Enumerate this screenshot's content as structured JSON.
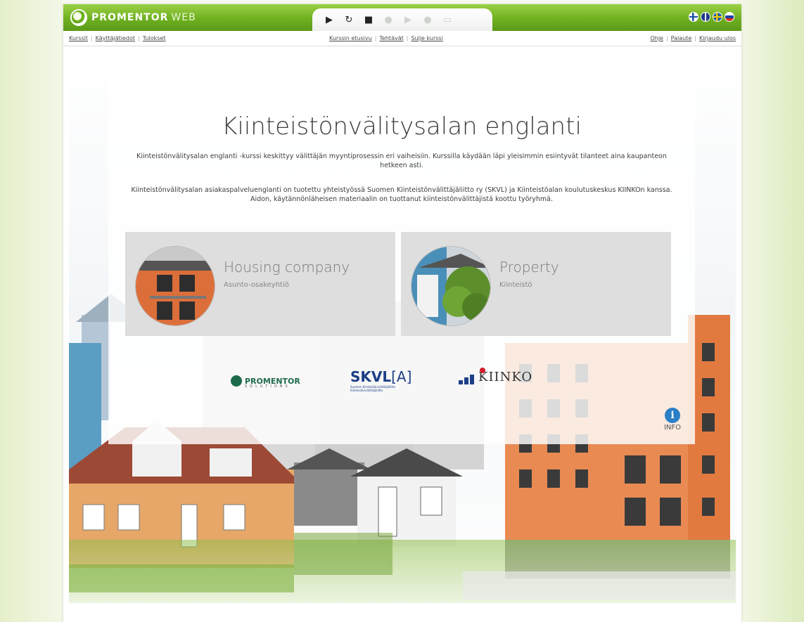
{
  "app": {
    "logo_text": "PROMENTOR",
    "logo_suffix": "WEB"
  },
  "player": {
    "buttons": [
      "play-icon",
      "restart-icon",
      "stop-icon",
      "prev-icon",
      "play-next-icon",
      "record-icon",
      "page-icon"
    ]
  },
  "languages": [
    "fi",
    "gb",
    "se",
    "ru"
  ],
  "links": {
    "left": [
      "Kurssit",
      "Käyttäjätiedot",
      "Tulokset"
    ],
    "middle": [
      "Kurssin etusivu",
      "Tehtävät",
      "Sulje kurssi"
    ],
    "right": [
      "Ohje",
      "Palaute",
      "Kirjaudu ulos"
    ]
  },
  "course": {
    "title": "Kiinteistönvälitysalan englanti",
    "description_1": "Kiinteistönvälitysalan englanti -kurssi keskittyy välittäjän myyntiprosessin eri vaiheisiin. Kurssilla käydään läpi yleisimmin esiintyvät tilanteet aina kaupanteon hetkeen asti.",
    "description_2": "Kiinteistönvälitysalan asiakaspalveluenglanti on tuotettu yhteistyössä Suomen Kiinteistönvälittäjäliitto ry (SKVL) ja Kiinteistöalan koulutuskeskus KIINKOn kanssa. Aidon, käytännönläheisen materiaalin on tuottanut kiinteistönvälittäjistä koottu työryhmä."
  },
  "modules": [
    {
      "title": "Housing company",
      "subtitle": "Asunto-osakeyhtiö"
    },
    {
      "title": "Property",
      "subtitle": "Kiinteistö"
    }
  ],
  "partners": {
    "promentor": "PROMENTOR",
    "promentor_sub": "SOLUTIONS",
    "skvl": "SKVL",
    "skvl_suffix": "[A]",
    "skvl_sub": "Suomen Kiinteistönvälittäjäliitto Kiinteistönvälittäjäliitto",
    "kiinko": "KIINKO"
  },
  "info_label": "INFO",
  "colors": {
    "brand_green": "#6fb020",
    "info_blue": "#2a7fc7",
    "kiinko_red": "#d41c2a",
    "skvl_blue": "#1d3f87"
  }
}
